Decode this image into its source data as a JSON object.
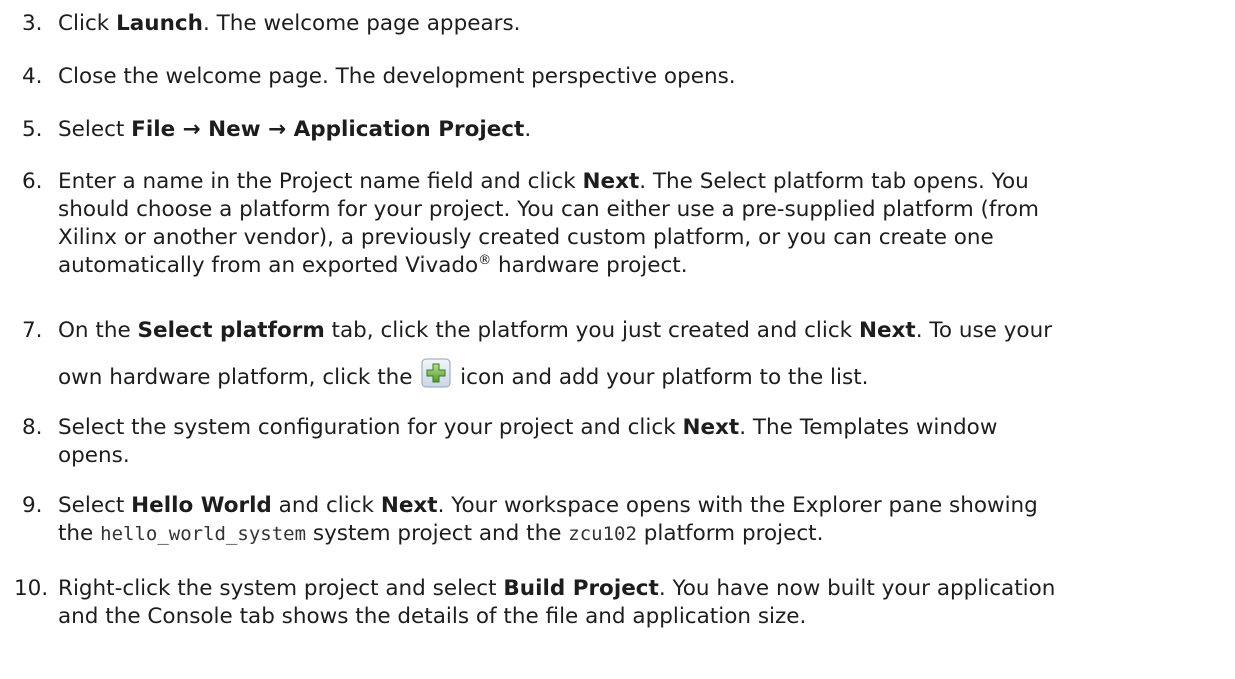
{
  "steps": [
    {
      "num": "3.",
      "a": "Click ",
      "b1": "Launch",
      "c": ". The welcome page appears."
    },
    {
      "num": "4.",
      "a": "Close the welcome page. The development perspective opens."
    },
    {
      "num": "5.",
      "a": "Select ",
      "b1": "File → New → Application Project",
      "c": "."
    },
    {
      "num": "6.",
      "l1a": "Enter a name in the Project name field and click ",
      "l1b": "Next",
      "l1c": ". The Select platform tab opens. You",
      "l2": "should choose a platform for your project. You can either use a pre-supplied platform (from",
      "l3": "Xilinx or another vendor), a previously created custom platform, or you can create one",
      "l4a": "automatically from an exported Vivado",
      "l4sup": "®",
      "l4b": " hardware project."
    },
    {
      "num": "7.",
      "l1a": "On the ",
      "l1b": "Select platform",
      "l1c": " tab, click the platform you just created and click ",
      "l1d": "Next",
      "l1e": ". To use your",
      "l2a": "own hardware platform, click the ",
      "l2b": " icon and add your platform to the list.",
      "icon": "add-plus-icon"
    },
    {
      "num": "8.",
      "l1a": "Select the system configuration for your project and click ",
      "l1b": "Next",
      "l1c": ". The Templates window",
      "l2": "opens."
    },
    {
      "num": "9.",
      "l1a": "Select ",
      "l1b": "Hello World",
      "l1c": " and click ",
      "l1d": "Next",
      "l1e": ". Your workspace opens with the Explorer pane showing",
      "l2a": "the ",
      "l2code1": "hello_world_system",
      "l2b": " system project and the ",
      "l2code2": "zcu102",
      "l2c": " platform project."
    },
    {
      "num": "10.",
      "l1a": "Right-click the system project and select ",
      "l1b": "Build Project",
      "l1c": ". You have now built your application",
      "l2": "and the Console tab shows the details of the file and application size."
    }
  ]
}
